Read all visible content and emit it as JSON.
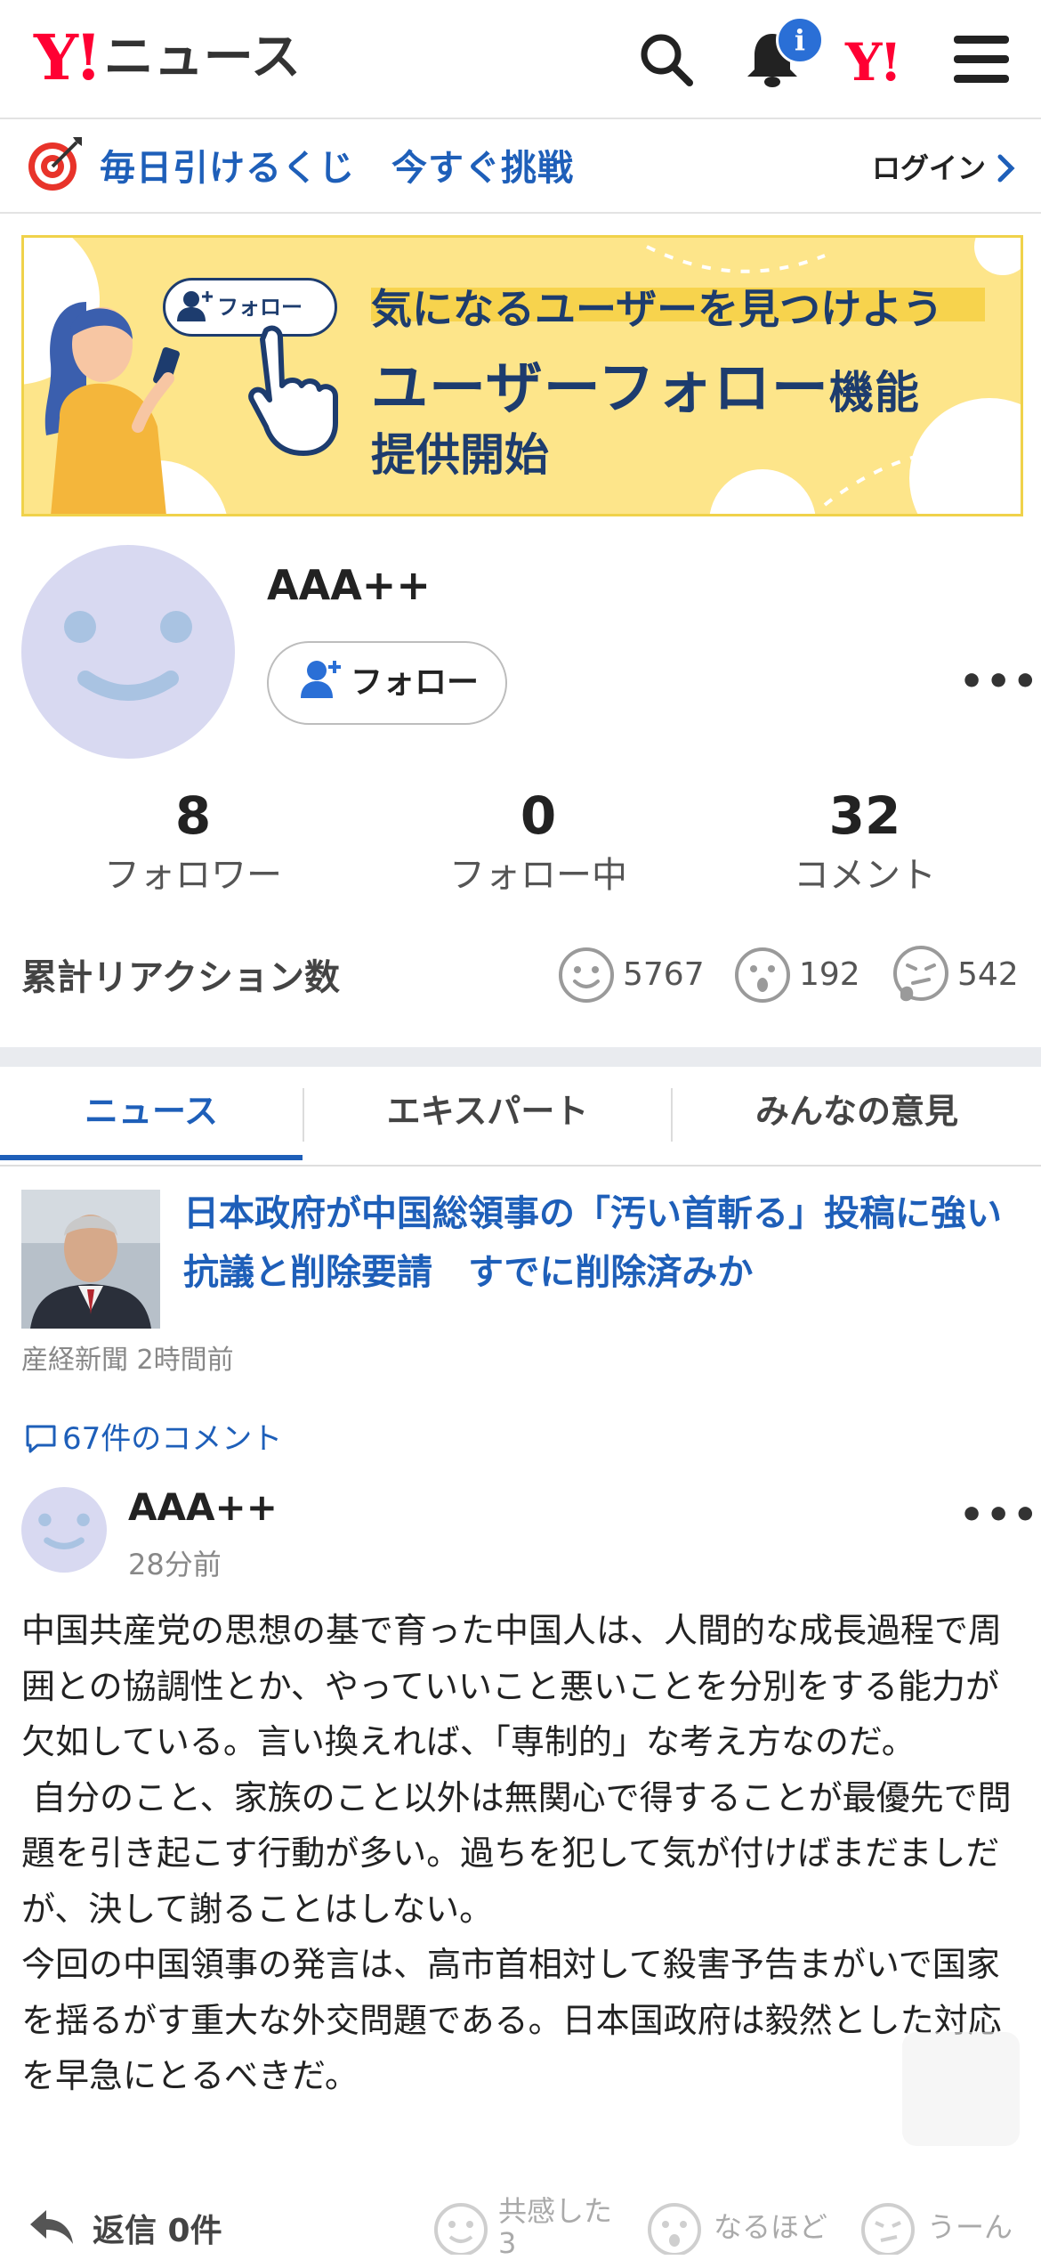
{
  "header": {
    "logo_y": "Y!",
    "logo_text": "ニュース",
    "notification_badge": "i",
    "brand_icon_text": "Y!",
    "icons": [
      "search-icon",
      "bell-icon",
      "yahoo-logo-icon",
      "menu-icon"
    ]
  },
  "lottery_bar": {
    "text": "毎日引けるくじ　今すぐ挑戦",
    "login_label": "ログイン",
    "icon": "target-icon"
  },
  "banner": {
    "follow_chip": "フォロー",
    "line1": "気になるユーザーを見つけよう",
    "line2_main": "ユーザーフォロー",
    "line2_small": "機能",
    "line3": "提供開始"
  },
  "profile": {
    "name": "AAA++",
    "follow_button": "フォロー",
    "stats": [
      {
        "value": "8",
        "label": "フォロワー"
      },
      {
        "value": "0",
        "label": "フォロー中"
      },
      {
        "value": "32",
        "label": "コメント"
      }
    ],
    "reactions_title": "累計リアクション数",
    "reactions": [
      {
        "icon": "smile-icon",
        "count": "5767"
      },
      {
        "icon": "surprised-icon",
        "count": "192"
      },
      {
        "icon": "thinking-icon",
        "count": "542"
      }
    ]
  },
  "tabs": [
    {
      "label": "ニュース",
      "active": true
    },
    {
      "label": "エキスパート",
      "active": false
    },
    {
      "label": "みんなの意見",
      "active": false
    }
  ],
  "article": {
    "title": "日本政府が中国総領事の「汚い首斬る」投稿に強い抗議と削除要請　すでに削除済みか",
    "source": "産経新聞",
    "time": "2時間前",
    "comment_count": "67件のコメント"
  },
  "comment": {
    "user": "AAA++",
    "time": "28分前",
    "body": "中国共産党の思想の基で育った中国人は、人間的な成長過程で周囲との協調性とか、やっていいこと悪いことを分別をする能力が欠如している。言い換えれば、「専制的」な考え方なのだ。\n 自分のこと、家族のこと以外は無関心で得することが最優先で問題を引き起こす行動が多い。過ちを犯して気が付けばまだましだが、決して謝ることはしない。\n今回の中国領事の発言は、高市首相対して殺害予告まがいで国家を揺るがす重大な外交問題である。日本国政府は毅然とした対応を早急にとるべきだ。",
    "reply_label": "返信 0件",
    "reactions": [
      {
        "label": "共感した",
        "count": "3"
      },
      {
        "label": "なるほど"
      },
      {
        "label": "うーん"
      }
    ]
  },
  "colors": {
    "brand_red": "#ff0033",
    "link_blue": "#1e5fb9",
    "banner_yellow": "#fde58a",
    "avatar_lavender": "#d8d9f1"
  }
}
